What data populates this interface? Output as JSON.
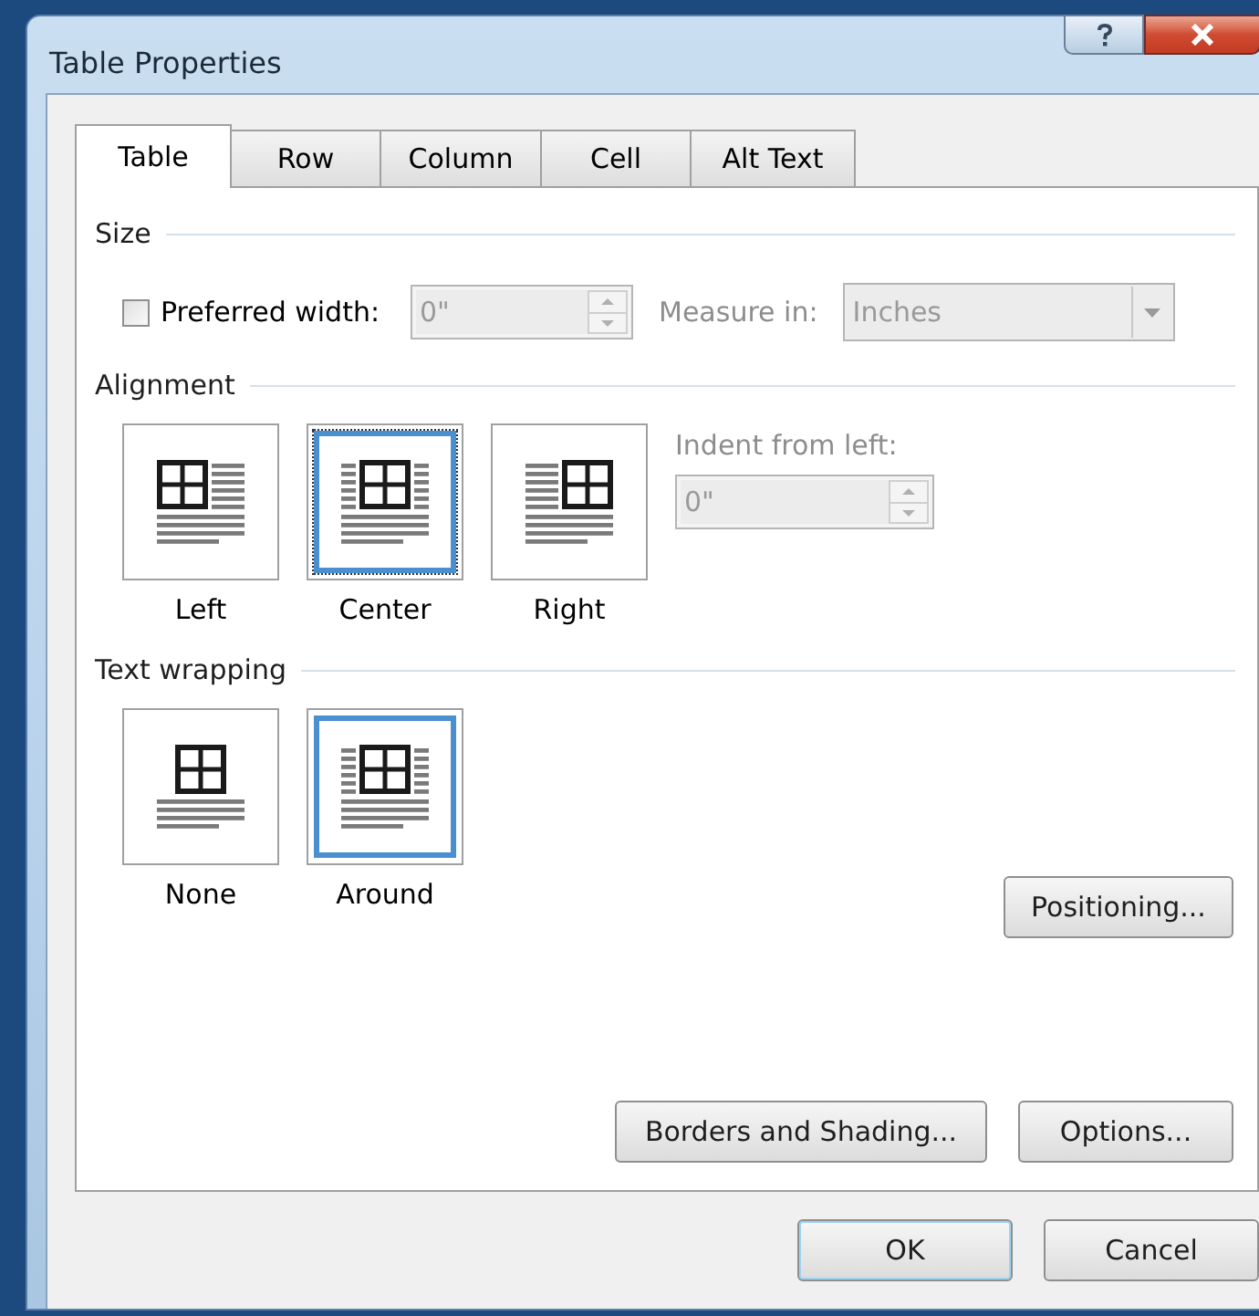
{
  "window": {
    "title": "Table Properties"
  },
  "tabs": [
    {
      "label": "Table",
      "selected": true
    },
    {
      "label": "Row",
      "selected": false
    },
    {
      "label": "Column",
      "selected": false
    },
    {
      "label": "Cell",
      "selected": false
    },
    {
      "label": "Alt Text",
      "selected": false
    }
  ],
  "size": {
    "heading": "Size",
    "preferred_width": {
      "label": "Preferred width:",
      "checked": false,
      "value": "0\"",
      "disabled": true
    },
    "measure_in": {
      "label": "Measure in:",
      "value": "Inches",
      "disabled": true
    }
  },
  "alignment": {
    "heading": "Alignment",
    "options": [
      {
        "label": "Left",
        "kind": "left",
        "selected": false,
        "focused": false
      },
      {
        "label": "Center",
        "kind": "center",
        "selected": true,
        "focused": true
      },
      {
        "label": "Right",
        "kind": "right",
        "selected": false,
        "focused": false
      }
    ],
    "indent": {
      "label": "Indent from left:",
      "value": "0\"",
      "disabled": true
    }
  },
  "text_wrapping": {
    "heading": "Text wrapping",
    "options": [
      {
        "label": "None",
        "kind": "none",
        "selected": false,
        "focused": false
      },
      {
        "label": "Around",
        "kind": "around",
        "selected": true,
        "focused": false
      }
    ],
    "positioning_button": "Positioning..."
  },
  "panel_buttons": [
    "Borders and Shading...",
    "Options..."
  ],
  "footer_buttons": [
    {
      "label": "OK",
      "default": true
    },
    {
      "label": "Cancel",
      "default": false
    }
  ]
}
